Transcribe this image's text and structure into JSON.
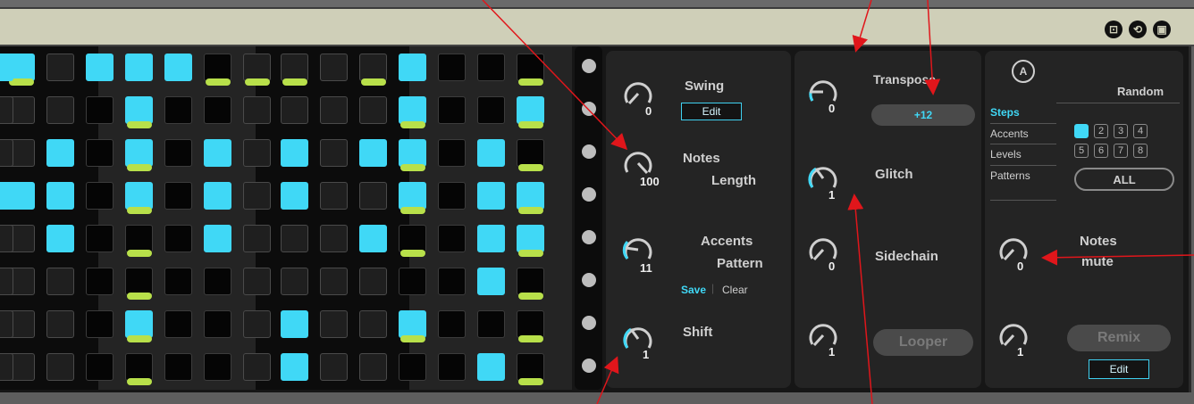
{
  "title_icons": [
    "loop-icon",
    "sync-icon",
    "save-icon"
  ],
  "colors": {
    "accent": "#40d8f6",
    "accent_green": "#b8e04a"
  },
  "sequencer": {
    "steps_on": [
      [
        1,
        0,
        1,
        1,
        1,
        0,
        0,
        0,
        0,
        0,
        1,
        0,
        0,
        0
      ],
      [
        0,
        0,
        0,
        1,
        0,
        0,
        0,
        0,
        0,
        0,
        1,
        0,
        0,
        1
      ],
      [
        0,
        1,
        0,
        1,
        0,
        1,
        0,
        1,
        0,
        1,
        1,
        0,
        1,
        0
      ],
      [
        1,
        1,
        0,
        1,
        0,
        1,
        0,
        1,
        0,
        0,
        1,
        0,
        1,
        1
      ],
      [
        0,
        1,
        0,
        0,
        0,
        1,
        0,
        0,
        0,
        1,
        0,
        0,
        1,
        1
      ],
      [
        0,
        0,
        0,
        0,
        0,
        0,
        0,
        0,
        0,
        0,
        0,
        0,
        1,
        0
      ],
      [
        0,
        0,
        0,
        1,
        0,
        0,
        0,
        1,
        0,
        0,
        1,
        0,
        0,
        0
      ],
      [
        0,
        0,
        0,
        0,
        0,
        0,
        0,
        1,
        0,
        0,
        0,
        0,
        1,
        0
      ]
    ],
    "accents": [
      [
        1,
        0,
        0,
        0,
        0,
        1,
        1,
        1,
        0,
        1,
        0,
        0,
        0,
        1
      ],
      [
        0,
        0,
        0,
        1,
        0,
        0,
        0,
        0,
        0,
        0,
        1,
        0,
        0,
        1
      ],
      [
        0,
        0,
        0,
        1,
        0,
        0,
        0,
        0,
        0,
        0,
        1,
        0,
        0,
        1
      ],
      [
        0,
        0,
        0,
        1,
        0,
        0,
        0,
        0,
        0,
        0,
        1,
        0,
        0,
        1
      ],
      [
        0,
        0,
        0,
        1,
        0,
        0,
        0,
        0,
        0,
        0,
        1,
        0,
        0,
        1
      ],
      [
        0,
        0,
        0,
        1,
        0,
        0,
        0,
        0,
        0,
        0,
        0,
        0,
        0,
        1
      ],
      [
        0,
        0,
        0,
        1,
        0,
        0,
        0,
        0,
        0,
        0,
        1,
        0,
        0,
        1
      ],
      [
        0,
        0,
        0,
        1,
        0,
        0,
        0,
        0,
        0,
        0,
        0,
        0,
        0,
        1
      ]
    ]
  },
  "panel1": {
    "swing": {
      "label": "Swing",
      "value": "0",
      "edit": "Edit"
    },
    "notes_length": {
      "label1": "Notes",
      "label2": "Length",
      "value": "100"
    },
    "accents_pattern": {
      "label1": "Accents",
      "label2": "Pattern",
      "value": "11",
      "save": "Save",
      "clear": "Clear"
    },
    "shift": {
      "label": "Shift",
      "value": "1"
    }
  },
  "panel2": {
    "transpose": {
      "label": "Transpose",
      "value": "0",
      "display": "+12"
    },
    "glitch": {
      "label": "Glitch",
      "value": "1"
    },
    "sidechain": {
      "label": "Sidechain",
      "value": "0"
    },
    "looper": {
      "label": "Looper",
      "value": "1"
    }
  },
  "panel3": {
    "a_button": "A",
    "random_label": "Random",
    "tabs": [
      "Steps",
      "Accents",
      "Levels",
      "Patterns"
    ],
    "active_tab": "Steps",
    "numbers": [
      "1",
      "2",
      "3",
      "4",
      "5",
      "6",
      "7",
      "8"
    ],
    "all_label": "ALL",
    "notes_mute": {
      "label1": "Notes",
      "label2": "mute",
      "value": "0"
    },
    "remix": {
      "label": "Remix",
      "value": "1",
      "edit": "Edit"
    }
  }
}
